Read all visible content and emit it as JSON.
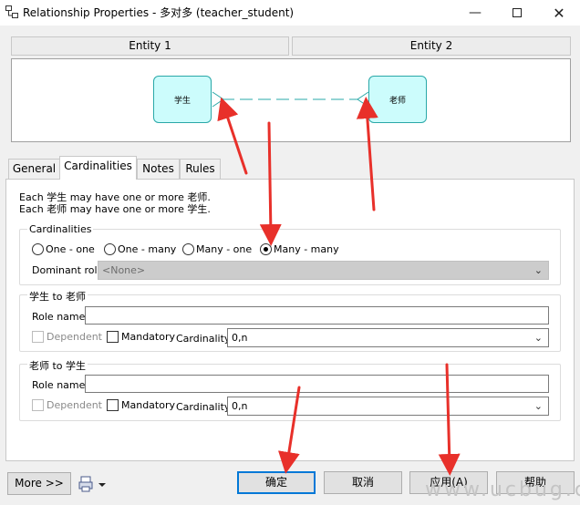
{
  "window": {
    "title": "Relationship Properties - 多对多 (teacher_student)"
  },
  "entities": {
    "header1": "Entity 1",
    "header2": "Entity 2",
    "entity1_name": "学生",
    "entity2_name": "老师"
  },
  "tabs": [
    "General",
    "Cardinalities",
    "Notes",
    "Rules"
  ],
  "description": {
    "line1": "Each 学生 may have one or more 老师.",
    "line2": "Each 老师 may have one or more 学生."
  },
  "cardinalities": {
    "group_label": "Cardinalities",
    "options": [
      "One - one",
      "One - many",
      "Many - one",
      "Many - many"
    ],
    "selected": "Many - many",
    "dominant_role_label": "Dominant role:",
    "dominant_role_value": "<None>"
  },
  "role1": {
    "group_label": "学生 to 老师",
    "role_name_label": "Role name:",
    "role_name_value": "",
    "dependent_label": "Dependent",
    "mandatory_label": "Mandatory",
    "cardinality_label": "Cardinality:",
    "cardinality_value": "0,n"
  },
  "role2": {
    "group_label": "老师 to 学生",
    "role_name_label": "Role name:",
    "role_name_value": "",
    "dependent_label": "Dependent",
    "mandatory_label": "Mandatory",
    "cardinality_label": "Cardinality:",
    "cardinality_value": "0,n"
  },
  "buttons": {
    "more": "More >>",
    "ok": "确定",
    "cancel": "取消",
    "apply": "应用(A)",
    "help": "帮助"
  },
  "watermark": "www.ucbug.co",
  "colors": {
    "entity_fill": "#ccfcfc",
    "entity_border": "#2aa8a8",
    "annotation_arrow": "#e8302a",
    "accent": "#0078d7"
  }
}
